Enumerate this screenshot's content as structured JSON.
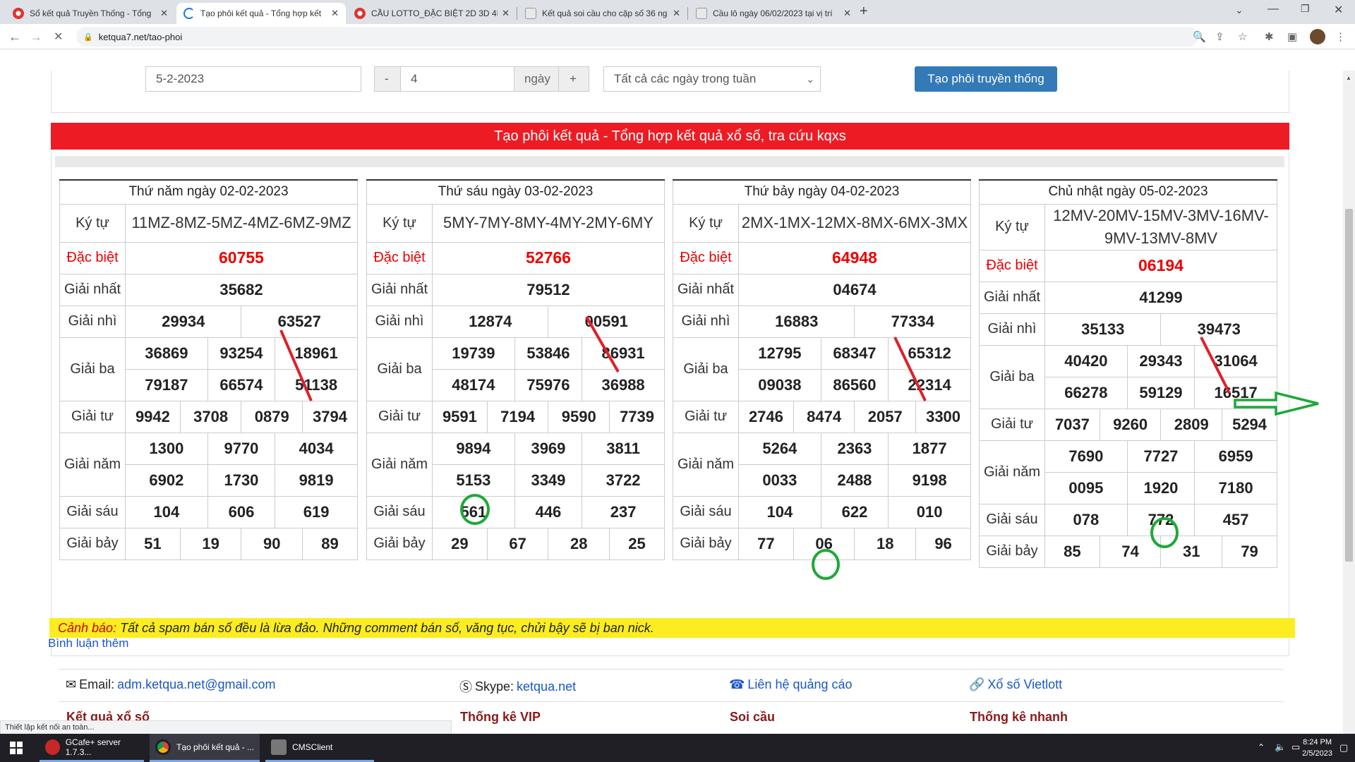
{
  "browser": {
    "tabs": [
      {
        "title": "Sổ kết quả Truyền Thống - Tổng",
        "icon": "site-icon-red",
        "active": false
      },
      {
        "title": "Tạo phôi kết quả - Tổng hợp kết",
        "icon": "loading-spinner",
        "active": true
      },
      {
        "title": "CẦU LOTTO_ĐẶC BIỆT 2D 3D 4D",
        "icon": "site-icon-red",
        "active": false
      },
      {
        "title": "Kết quả soi cầu cho cặp số 36 ng",
        "icon": "rbk-icon",
        "active": false
      },
      {
        "title": "Cầu lô ngày 06/02/2023 tại vị trí",
        "icon": "rbk-icon",
        "active": false
      }
    ],
    "new_tab": "+",
    "url": "ketqua7.net/tao-phoi"
  },
  "form": {
    "date_value": "5-2-2023",
    "minus": "-",
    "days_value": "4",
    "days_unit": "ngày",
    "plus": "+",
    "weekday_select": "Tất cả các ngày trong tuần",
    "create_button": "Tạo phôi truyền thống"
  },
  "banner_title": "Tạo phôi kết quả - Tổng hợp kết quả xổ số, tra cứu kqxs",
  "labels": {
    "ky_tu": "Ký tự",
    "dac_biet": "Đặc biệt",
    "giai_nhat": "Giải nhất",
    "giai_nhi": "Giải nhì",
    "giai_ba": "Giải ba",
    "giai_tu": "Giải tư",
    "giai_nam": "Giải năm",
    "giai_sau": "Giải sáu",
    "giai_bay": "Giải bảy"
  },
  "results": [
    {
      "date": "Thứ năm ngày 02-02-2023",
      "ky_tu": "11MZ-8MZ-5MZ-4MZ-6MZ-9MZ",
      "dac_biet": "60755",
      "giai_nhat": "35682",
      "giai_nhi": [
        "29934",
        "63527"
      ],
      "giai_ba": [
        "36869",
        "93254",
        "18961",
        "79187",
        "66574",
        "51138"
      ],
      "giai_tu": [
        "9942",
        "3708",
        "0879",
        "3794"
      ],
      "giai_nam": [
        "1300",
        "9770",
        "4034",
        "6902",
        "1730",
        "9819"
      ],
      "giai_sau": [
        "104",
        "606",
        "619"
      ],
      "giai_bay": [
        "51",
        "19",
        "90",
        "89"
      ]
    },
    {
      "date": "Thứ sáu ngày 03-02-2023",
      "ky_tu": "5MY-7MY-8MY-4MY-2MY-6MY",
      "dac_biet": "52766",
      "giai_nhat": "79512",
      "giai_nhi": [
        "12874",
        "00591"
      ],
      "giai_ba": [
        "19739",
        "53846",
        "86931",
        "48174",
        "75976",
        "36988"
      ],
      "giai_tu": [
        "9591",
        "7194",
        "9590",
        "7739"
      ],
      "giai_nam": [
        "9894",
        "3969",
        "3811",
        "5153",
        "3349",
        "3722"
      ],
      "giai_sau": [
        "561",
        "446",
        "237"
      ],
      "giai_bay": [
        "29",
        "67",
        "28",
        "25"
      ]
    },
    {
      "date": "Thứ bảy ngày 04-02-2023",
      "ky_tu": "2MX-1MX-12MX-8MX-6MX-3MX",
      "dac_biet": "64948",
      "giai_nhat": "04674",
      "giai_nhi": [
        "16883",
        "77334"
      ],
      "giai_ba": [
        "12795",
        "68347",
        "65312",
        "09038",
        "86560",
        "22314"
      ],
      "giai_tu": [
        "2746",
        "8474",
        "2057",
        "3300"
      ],
      "giai_nam": [
        "5264",
        "2363",
        "1877",
        "0033",
        "2488",
        "9198"
      ],
      "giai_sau": [
        "104",
        "622",
        "010"
      ],
      "giai_bay": [
        "77",
        "06",
        "18",
        "96"
      ]
    },
    {
      "date": "Chủ nhật ngày 05-02-2023",
      "ky_tu": "12MV-20MV-15MV-3MV-16MV-9MV-13MV-8MV",
      "dac_biet": "06194",
      "giai_nhat": "41299",
      "giai_nhi": [
        "35133",
        "39473"
      ],
      "giai_ba": [
        "40420",
        "29343",
        "31064",
        "66278",
        "59129",
        "16517"
      ],
      "giai_tu": [
        "7037",
        "9260",
        "2809",
        "5294"
      ],
      "giai_nam": [
        "7690",
        "7727",
        "6959",
        "0095",
        "1920",
        "7180"
      ],
      "giai_sau": [
        "078",
        "772",
        "457"
      ],
      "giai_bay": [
        "85",
        "74",
        "31",
        "79"
      ]
    }
  ],
  "warning": {
    "label": "Cảnh báo:",
    "text": "Tất cả spam bán số đều là lừa đảo. Những comment bán số, văng tục, chửi bậy sẽ bị ban nick."
  },
  "comment_link": "Bình luận thêm",
  "footer": {
    "email_label": "Email:",
    "email": "adm.ketqua.net@gmail.com",
    "skype_label": "Skype:",
    "skype": "ketqua.net",
    "ads": "Liên hệ quảng cáo",
    "vietlott": "Xổ số Vietlott",
    "headings": [
      "Kết quả xổ số",
      "Thống kê VIP",
      "Soi cầu",
      "Thống kê nhanh"
    ]
  },
  "status_text": "Thiết lập kết nối an toàn...",
  "taskbar": {
    "items": [
      "GCafe+ server 1.7.3...",
      "Tạo phôi kết quả - ...",
      "CMSClient"
    ],
    "time": "8:24 PM",
    "date": "2/5/2023"
  },
  "colors": {
    "banner_red": "#ed1c24",
    "button_blue": "#337ab7",
    "warning_yellow": "#fbed21",
    "annotation_red": "#e0202a",
    "annotation_green": "#1fa83a"
  }
}
